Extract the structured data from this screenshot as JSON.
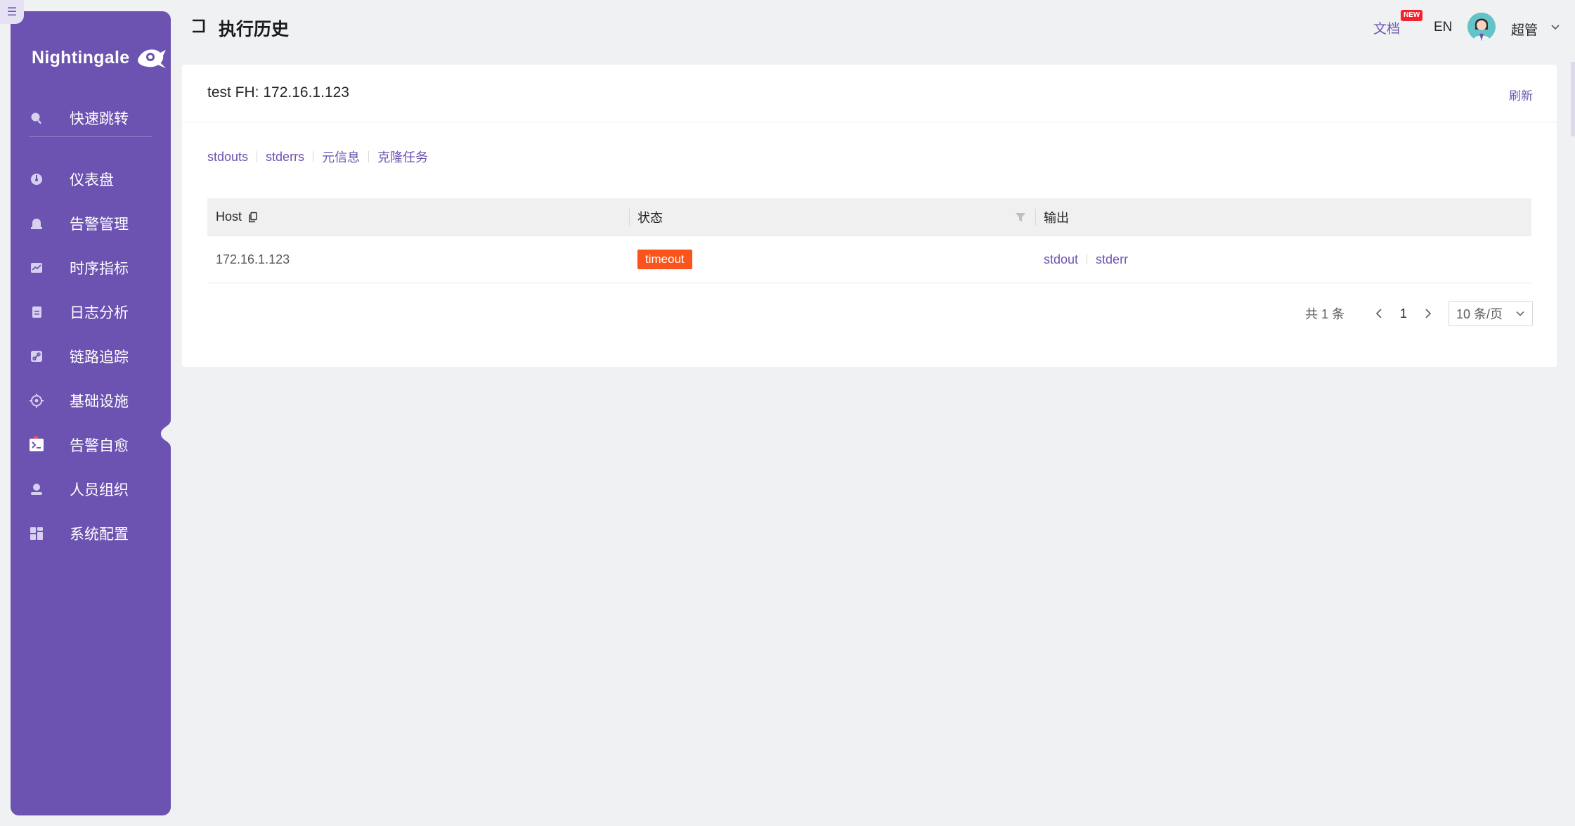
{
  "app": {
    "brand": "Nightingale"
  },
  "sidebar": {
    "items": [
      {
        "label": "快速跳转",
        "icon": "search-icon"
      },
      {
        "label": "仪表盘",
        "icon": "dashboard-icon"
      },
      {
        "label": "告警管理",
        "icon": "alarm-bell-icon"
      },
      {
        "label": "时序指标",
        "icon": "line-chart-icon"
      },
      {
        "label": "日志分析",
        "icon": "log-file-icon"
      },
      {
        "label": "链路追踪",
        "icon": "link-icon"
      },
      {
        "label": "基础设施",
        "icon": "crosshair-icon"
      },
      {
        "label": "告警自愈",
        "icon": "terminal-icon"
      },
      {
        "label": "人员组织",
        "icon": "user-icon"
      },
      {
        "label": "系统配置",
        "icon": "grid-icon"
      }
    ],
    "active_index": 7
  },
  "header": {
    "title": "执行历史",
    "docs_label": "文档",
    "new_badge": "NEW",
    "lang_label": "EN",
    "user_name": "超管"
  },
  "card": {
    "title": "test FH: 172.16.1.123",
    "refresh_label": "刷新",
    "tabs": [
      "stdouts",
      "stderrs",
      "元信息",
      "克隆任务"
    ]
  },
  "table": {
    "columns": [
      "Host",
      "状态",
      "输出"
    ],
    "rows": [
      {
        "host": "172.16.1.123",
        "status": "timeout",
        "outputs": [
          "stdout",
          "stderr"
        ]
      }
    ]
  },
  "pagination": {
    "total_label": "共 1 条",
    "current_page": "1",
    "page_size_label": "10 条/页"
  },
  "colors": {
    "primary": "#6c53b1",
    "status_timeout": "#fa541c",
    "badge_red": "#f5222d"
  }
}
